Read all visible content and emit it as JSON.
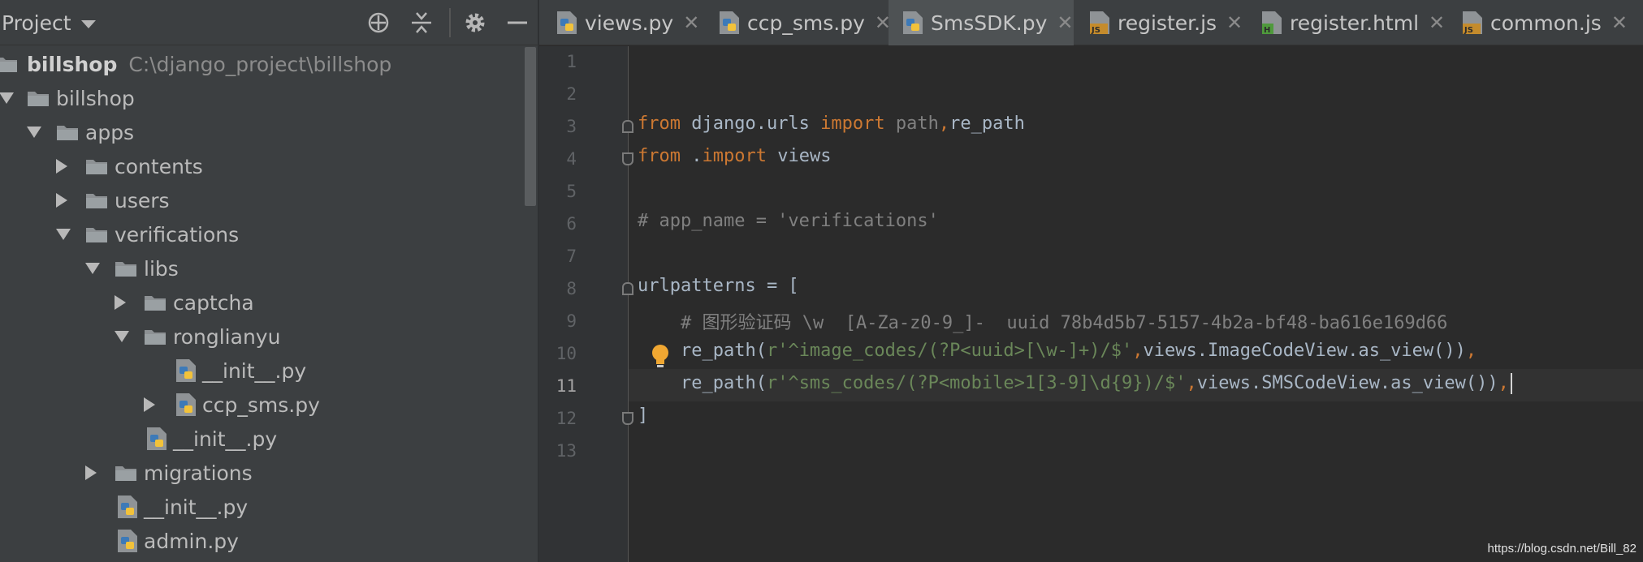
{
  "project_panel": {
    "title": "Project",
    "tree": [
      {
        "label": "billshop",
        "path": "C:\\django_project\\billshop",
        "kind": "root"
      },
      {
        "label": "billshop",
        "kind": "folder",
        "expanded": true
      },
      {
        "label": "apps",
        "kind": "folder",
        "expanded": true
      },
      {
        "label": "contents",
        "kind": "folder",
        "expanded": false
      },
      {
        "label": "users",
        "kind": "folder",
        "expanded": false
      },
      {
        "label": "verifications",
        "kind": "folder",
        "expanded": true
      },
      {
        "label": "libs",
        "kind": "folder",
        "expanded": true
      },
      {
        "label": "captcha",
        "kind": "folder",
        "expanded": false
      },
      {
        "label": "ronglianyu",
        "kind": "folder",
        "expanded": true
      },
      {
        "label": "__init__.py",
        "kind": "python-file"
      },
      {
        "label": "ccp_sms.py",
        "kind": "python-file",
        "expandable": true
      },
      {
        "label": "__init__.py",
        "kind": "python-file"
      },
      {
        "label": "migrations",
        "kind": "folder",
        "expanded": false
      },
      {
        "label": "__init__.py",
        "kind": "python-file"
      },
      {
        "label": "admin.py",
        "kind": "python-file"
      }
    ]
  },
  "tabs": [
    {
      "label": "views.py",
      "icon": "python-file-icon",
      "active": false
    },
    {
      "label": "ccp_sms.py",
      "icon": "python-file-icon",
      "active": false
    },
    {
      "label": "SmsSDK.py",
      "icon": "python-file-icon",
      "active": true
    },
    {
      "label": "register.js",
      "icon": "javascript-file-icon",
      "active": false
    },
    {
      "label": "register.html",
      "icon": "html-file-icon",
      "active": false
    },
    {
      "label": "common.js",
      "icon": "javascript-file-icon",
      "active": false
    }
  ],
  "tab_close_glyph": "✕",
  "editor": {
    "line_numbers": [
      "1",
      "2",
      "3",
      "4",
      "5",
      "6",
      "7",
      "8",
      "9",
      "10",
      "11",
      "12",
      "13"
    ],
    "current_line": "11",
    "code": {
      "l3": {
        "kw1": "from",
        "mod": " django.urls ",
        "kw2": "import",
        "name1": " path",
        "comma": ",",
        "name2": "re_path"
      },
      "l4": {
        "kw1": "from",
        "mod": " .",
        "kw2": "import",
        "name": " views"
      },
      "l6": "# app_name = 'verifications'",
      "l8": "urlpatterns = [",
      "l9": "    # 图形验证码 \\w  [A-Za-z0-9_]-  uuid 78b4d5b7-5157-4b2a-bf48-ba616e169d66",
      "l10": {
        "indent": "    ",
        "fn": "re_path(",
        "str": "r'^image_codes/(?P<uuid>[\\w-]+)/$'",
        "comma": ",",
        "rest": "views.ImageCodeView.as_view())",
        "trail": ","
      },
      "l11": {
        "indent": "    ",
        "fn": "re_path(",
        "str": "r'^sms_codes/(?P<mobile>1[3-9]\\d{9})/$'",
        "comma": ",",
        "rest": "views.SMSCodeView.as_view())",
        "trail": ","
      },
      "l12": "]"
    }
  },
  "watermark": "https://blog.csdn.net/Bill_82",
  "colors": {
    "keyword": "#cc7832",
    "string": "#6a8759",
    "comment": "#808080",
    "text": "#a9b7c6",
    "panel": "#3c3f41",
    "editor": "#2b2b2b"
  }
}
